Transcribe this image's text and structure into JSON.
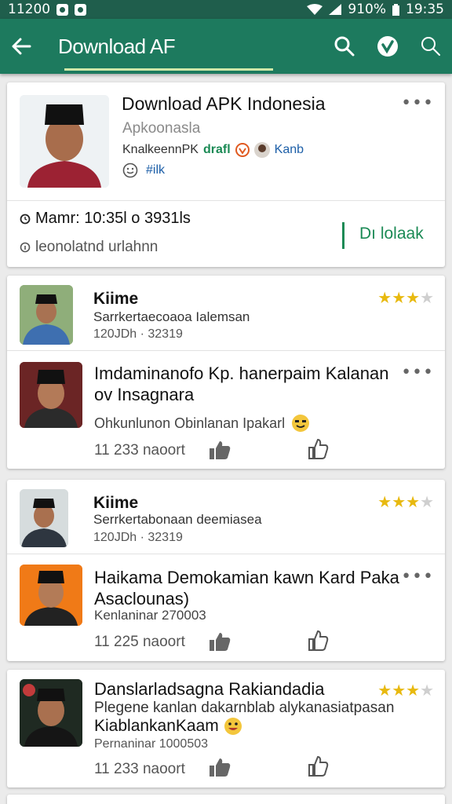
{
  "status_bar": {
    "time_left": "11200",
    "battery": "910%",
    "time_right": "19:35"
  },
  "app_bar": {
    "title": "Download AF"
  },
  "header_card": {
    "title": "Download APK Indonesia",
    "subtitle": "Apkoonasla",
    "meta_prefix": "KnalkeennPK",
    "meta_green": "drafl",
    "meta_blue": "Kanb",
    "tag": "#ilk",
    "info": "Mamr: 10:35l o 3931ls",
    "detail": "leonolatnd urlahnn",
    "action": "Dı lolaak"
  },
  "posts": [
    {
      "name": "Kiime",
      "desc": "Sarrkertaecoaoa Ialemsan",
      "time": "120JDh · 32319",
      "rating": 3,
      "text_line1": "Imdaminanofo Kp. hanerpaim Kalanan",
      "text_line2": "ov Insagnara",
      "note": "Ohkunlunon Obinlanan Ipakarl",
      "count": "11 233 naoort"
    },
    {
      "name": "Kiime",
      "desc": "Serrkertabonaan deemiasea",
      "time": "120JDh · 32319",
      "rating": 3,
      "text_line1": "Haikama Demokamian kawn Kard Paka",
      "text_line2": "Asaclounas)",
      "note": "Kenlaninar 270003",
      "count": "11 225 naoort"
    },
    {
      "name": "Danslarladsagna Rakiandadia",
      "desc": "Plegene kanlan dakarnblab alykanasiatpasan",
      "desc2": "KiablankanKaam",
      "time": "Pernaninar 1000503",
      "rating": 3,
      "count": "11 233 naoort"
    }
  ],
  "colors": {
    "appbar": "#1d7a5e",
    "statusbar": "#1f5e4c",
    "accent": "#1b8a55",
    "star": "#e8b90f"
  }
}
